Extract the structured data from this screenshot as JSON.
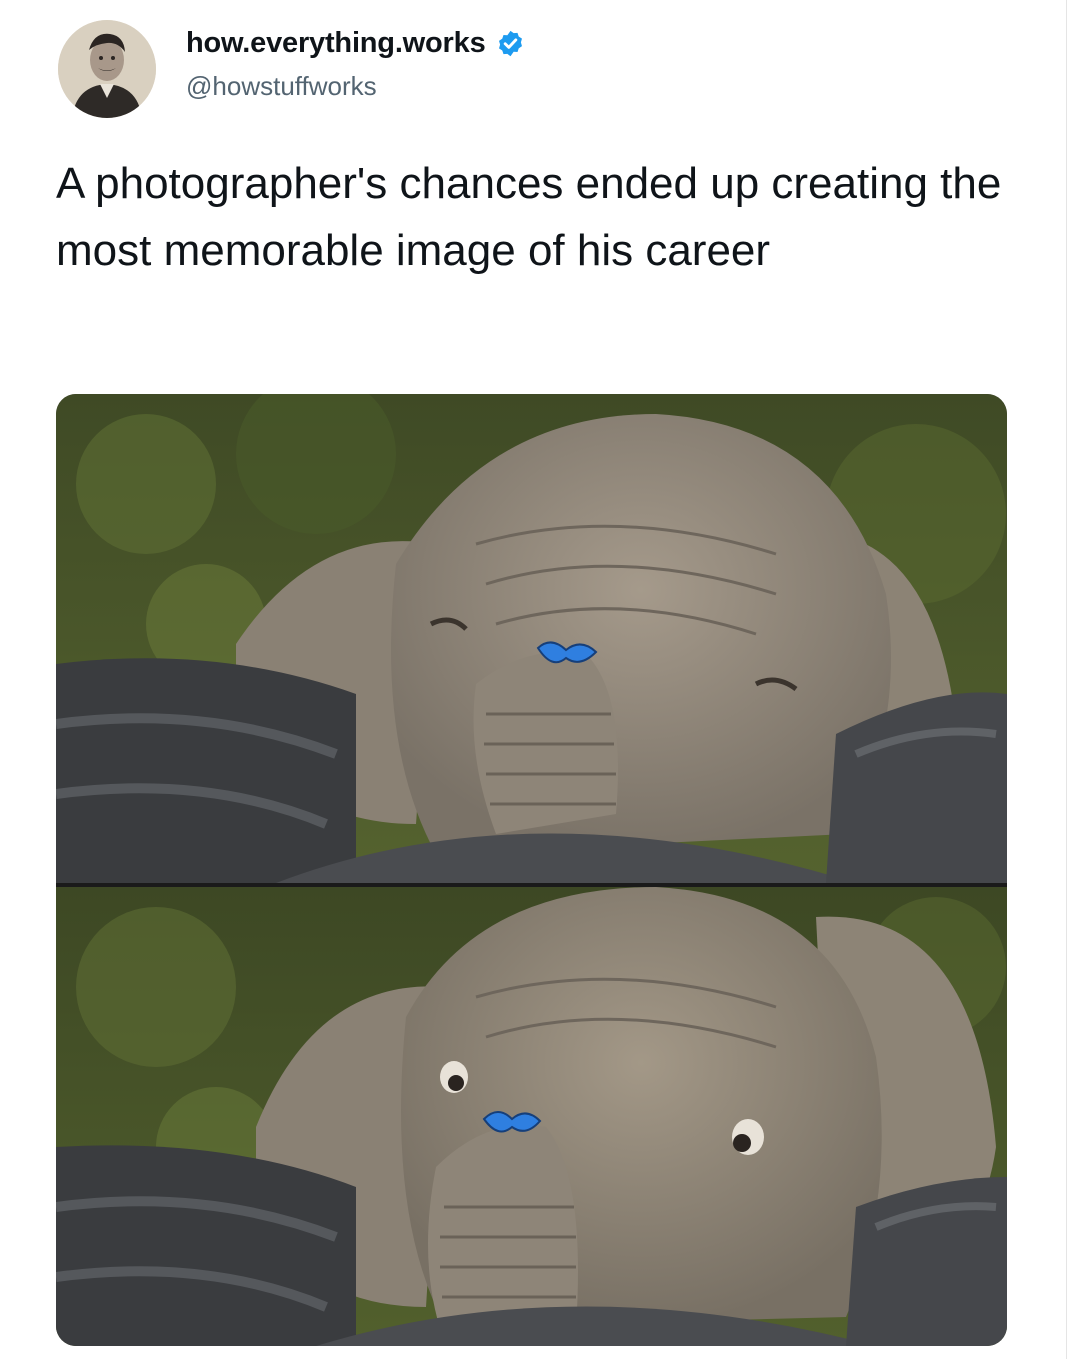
{
  "post": {
    "display_name": "how.everything.works",
    "handle": "@howstuffworks",
    "verified": true,
    "text": "A photographer's chances ended up creating the most memorable image of his career"
  },
  "icons": {
    "verified": "verified-badge-icon",
    "avatar": "avatar-portrait"
  },
  "colors": {
    "text": "#0f1419",
    "secondary_text": "#536471",
    "verified_blue": "#1d9bf0",
    "butterfly_blue": "#2f7fe0"
  }
}
